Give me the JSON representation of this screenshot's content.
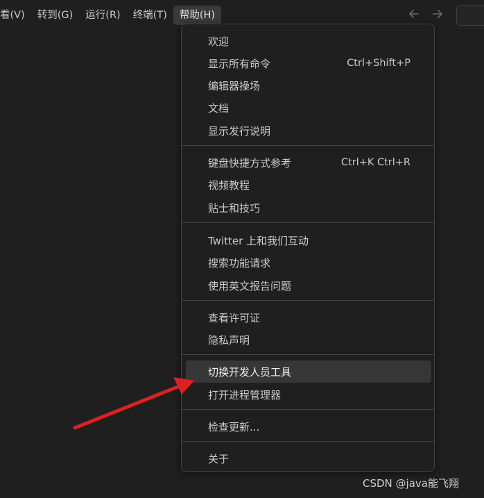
{
  "menubar": {
    "items": [
      {
        "label": "看(V)"
      },
      {
        "label": "转到(G)"
      },
      {
        "label": "运行(R)"
      },
      {
        "label": "终端(T)"
      },
      {
        "label": "帮助(H)",
        "active": true
      }
    ]
  },
  "nav": {
    "back_icon": "arrow-left-icon",
    "forward_icon": "arrow-right-icon"
  },
  "help_menu": {
    "groups": [
      [
        {
          "label": "欢迎",
          "shortcut": ""
        },
        {
          "label": "显示所有命令",
          "shortcut": "Ctrl+Shift+P"
        },
        {
          "label": "编辑器操场",
          "shortcut": ""
        },
        {
          "label": "文档",
          "shortcut": ""
        },
        {
          "label": "显示发行说明",
          "shortcut": ""
        }
      ],
      [
        {
          "label": "键盘快捷方式参考",
          "shortcut": "Ctrl+K Ctrl+R"
        },
        {
          "label": "视频教程",
          "shortcut": ""
        },
        {
          "label": "贴士和技巧",
          "shortcut": ""
        }
      ],
      [
        {
          "label": "Twitter 上和我们互动",
          "shortcut": ""
        },
        {
          "label": "搜索功能请求",
          "shortcut": ""
        },
        {
          "label": "使用英文报告问题",
          "shortcut": ""
        }
      ],
      [
        {
          "label": "查看许可证",
          "shortcut": ""
        },
        {
          "label": "隐私声明",
          "shortcut": ""
        }
      ],
      [
        {
          "label": "切换开发人员工具",
          "shortcut": "",
          "highlighted": true
        },
        {
          "label": "打开进程管理器",
          "shortcut": ""
        }
      ],
      [
        {
          "label": "检查更新...",
          "shortcut": ""
        }
      ],
      [
        {
          "label": "关于",
          "shortcut": ""
        }
      ]
    ]
  },
  "annotation": {
    "arrow_color": "#e02020"
  },
  "watermark": "CSDN @java能飞翔",
  "colors": {
    "background": "#1f1f1f",
    "menu_border": "#454545",
    "hover": "#363636",
    "text": "#cccccc"
  }
}
